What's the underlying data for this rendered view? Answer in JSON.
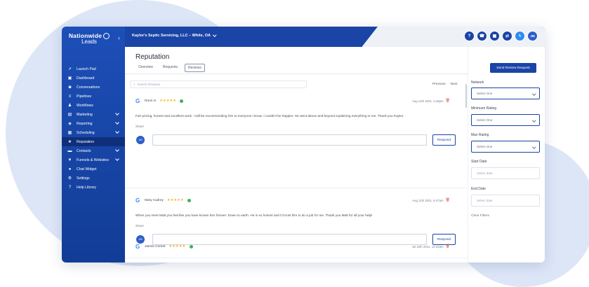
{
  "brand": {
    "line1": "Nationwide",
    "line2": "Leads"
  },
  "location": "Kaylor's Septic Servicing, LLC – White, OA",
  "top_icons": [
    "question-icon",
    "phone-icon",
    "grid-icon",
    "refresh-icon",
    "notification-icon"
  ],
  "user_initials": "JM",
  "sidebar": {
    "items": [
      {
        "label": "Launch Pad",
        "icon": "rocket-icon"
      },
      {
        "label": "Dashboard",
        "icon": "dashboard-icon"
      },
      {
        "label": "Conversations",
        "icon": "chat-icon"
      },
      {
        "label": "Pipelines",
        "icon": "pipeline-icon"
      },
      {
        "label": "Workflows",
        "icon": "workflow-icon"
      },
      {
        "label": "Marketing",
        "icon": "megaphone-icon"
      },
      {
        "label": "Reporting",
        "icon": "report-icon"
      },
      {
        "label": "Scheduling",
        "icon": "calendar-icon"
      },
      {
        "label": "Reputation",
        "icon": "star-icon"
      },
      {
        "label": "Contacts",
        "icon": "contacts-icon"
      },
      {
        "label": "Funnels & Websites",
        "icon": "funnel-icon"
      },
      {
        "label": "Chat Widget",
        "icon": "chat-widget-icon"
      },
      {
        "label": "Settings",
        "icon": "gear-icon"
      },
      {
        "label": "Help Library",
        "icon": "help-icon"
      }
    ]
  },
  "page": {
    "title": "Reputation",
    "tabs": [
      "Overview",
      "Requests",
      "Reviews"
    ],
    "search_placeholder": "Search Reviews",
    "pager": {
      "previous": "Previous",
      "next": "Next"
    }
  },
  "reviews": [
    {
      "source": "G",
      "name": "Ronn H",
      "stars": "★★★★★",
      "date": "Aug 12th 2021, 4:46pm",
      "text": "Fair pricing, honest and excellent work. I will be recommending him to everyone I know. I couldn't be happier. He went above and beyond explaining everything to me. Thank you Kaylor.",
      "share": "Share",
      "respond": "Respond"
    },
    {
      "source": "G",
      "name": "Mary Audrey",
      "stars": "★★★★★",
      "date": "Aug 11th 2021, 6:47am",
      "text": "When you meet Matt you feel like you have known him forever. Down to earth. He is so honest and I'd trust him to do a job for me. Thank you Matt for all your help!",
      "share": "Share",
      "respond": "Respond"
    },
    {
      "source": "G",
      "name": "Jaimie Corant",
      "stars": "★★★★★",
      "date": "Jul 15th 2021, 12:32am"
    }
  ],
  "filters": {
    "send_button": "Send Review Request",
    "network_label": "Network",
    "network_value": "Select One",
    "min_rating_label": "Minimum Rating",
    "min_rating_value": "Select One",
    "max_rating_label": "Max Rating",
    "max_rating_value": "Select One",
    "start_date_label": "Start Date",
    "start_date_placeholder": "Select date",
    "end_date_label": "End Date",
    "end_date_placeholder": "Select date",
    "clear": "Clear Filters"
  },
  "colors": {
    "primary": "#1a44a6",
    "sidebar": "#1d4fb8",
    "active_nav": "#0e2f7a",
    "star": "#f3b01b",
    "verified": "#3fb05a"
  }
}
